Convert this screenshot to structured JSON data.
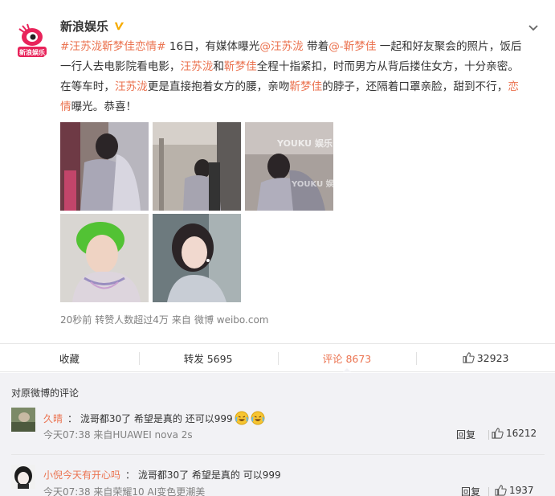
{
  "post": {
    "author": "新浪娱乐",
    "avatar_text": "新浪娱乐",
    "text_segments": [
      {
        "t": "#汪苏泷靳梦佳恋情#",
        "k": "tag"
      },
      {
        "t": " 16日，有媒体曝光",
        "k": "plain"
      },
      {
        "t": "@汪苏泷",
        "k": "mention"
      },
      {
        "t": " 带着",
        "k": "plain"
      },
      {
        "t": "@-靳梦佳",
        "k": "mention"
      },
      {
        "t": " 一起和好友聚会的照片，饭后一行人去电影院看电影，",
        "k": "plain"
      },
      {
        "t": "汪苏泷",
        "k": "name"
      },
      {
        "t": "和",
        "k": "plain"
      },
      {
        "t": "靳梦佳",
        "k": "name"
      },
      {
        "t": "全程十指紧扣，时而男方从背后搂住女方，十分亲密。在等车时，",
        "k": "plain"
      },
      {
        "t": "汪苏泷",
        "k": "name"
      },
      {
        "t": "更是直接抱着女方的腰，亲吻",
        "k": "plain"
      },
      {
        "t": "靳梦佳",
        "k": "name"
      },
      {
        "t": "的脖子，还隔着口罩亲脸，甜到不行，",
        "k": "plain"
      },
      {
        "t": "恋情",
        "k": "kw"
      },
      {
        "t": "曝光。恭喜！",
        "k": "plain"
      }
    ],
    "watermark": "YOUKU 娱乐",
    "meta": {
      "time": "20秒前",
      "reposts_note": "转赞人数超过4万",
      "source_prefix": "来自",
      "source": "微博 weibo.com"
    }
  },
  "actions": {
    "favorite": "收藏",
    "repost": "转发 5695",
    "comment": "评论 8673",
    "like": "32923"
  },
  "comments": {
    "header": "对原微博的评论",
    "items": [
      {
        "user": "久晴",
        "text": "： 泷哥都30了 希望是真的 还可以999",
        "time": "今天07:38 来自HUAWEI nova 2s",
        "reply": "回复",
        "likes": "16212"
      },
      {
        "user": "小倪今天有开心吗",
        "text": "： 泷哥都30了 希望是真的 可以999",
        "time": "今天07:38 来自荣耀10 AI变色更潮美",
        "reply": "回复",
        "likes": "1937"
      }
    ]
  },
  "colors": {
    "accent": "#eb7350",
    "muted": "#808080",
    "comment_bg": "#f2f2f5",
    "verified": "#f6ab00"
  },
  "icons": [
    "sina-ent-avatar",
    "verified-icon",
    "chevron-down-icon",
    "thumbs-up-icon",
    "laugh-cry-emoji"
  ]
}
